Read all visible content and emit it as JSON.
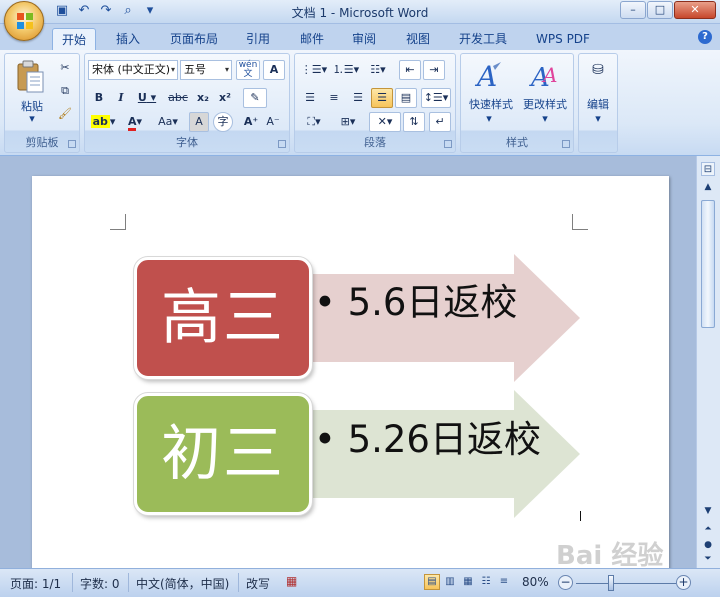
{
  "window": {
    "title": "文档 1 - Microsoft Word",
    "qat_icons": [
      "save-icon",
      "undo-icon",
      "redo-icon",
      "print-preview-icon",
      "customize-qat-icon"
    ],
    "controls": {
      "minimize": "–",
      "maximize": "□",
      "close": "✕"
    }
  },
  "tabs": [
    "开始",
    "插入",
    "页面布局",
    "引用",
    "邮件",
    "审阅",
    "视图",
    "开发工具",
    "WPS PDF"
  ],
  "active_tab": "开始",
  "ribbon": {
    "clipboard": {
      "label": "剪贴板",
      "paste": "粘贴"
    },
    "font": {
      "label": "字体",
      "font_name": "宋体 (中文正文)",
      "font_size": "五号",
      "wen": "wén 文",
      "bold": "B",
      "italic": "I",
      "underline": "U",
      "strike": "abc",
      "subscript": "x₂",
      "superscript": "x²",
      "aa": "Aa",
      "grow": "A",
      "shrink": "A",
      "char_border": "A",
      "char_shade": "A",
      "enclose": "字"
    },
    "paragraph": {
      "label": "段落"
    },
    "styles": {
      "label": "样式",
      "quick_styles": "快速样式",
      "change_styles": "更改样式"
    },
    "editing": {
      "label": "编辑",
      "edit": "编辑"
    }
  },
  "document": {
    "items": [
      {
        "label": "高三",
        "text": "5.6日返校",
        "label_color": "#c0504d",
        "arrow_color": "#e6d0cf"
      },
      {
        "label": "初三",
        "text": "5.26日返校",
        "label_color": "#9bbb59",
        "arrow_color": "#dde4d3"
      }
    ],
    "bullet": "•"
  },
  "statusbar": {
    "page": "页面: 1/1",
    "words": "字数: 0",
    "language": "中文(简体，中国)",
    "overtype": "改写",
    "zoom": "80%",
    "zoom_minus": "−",
    "zoom_plus": "+"
  },
  "watermark": "Bai 经验"
}
